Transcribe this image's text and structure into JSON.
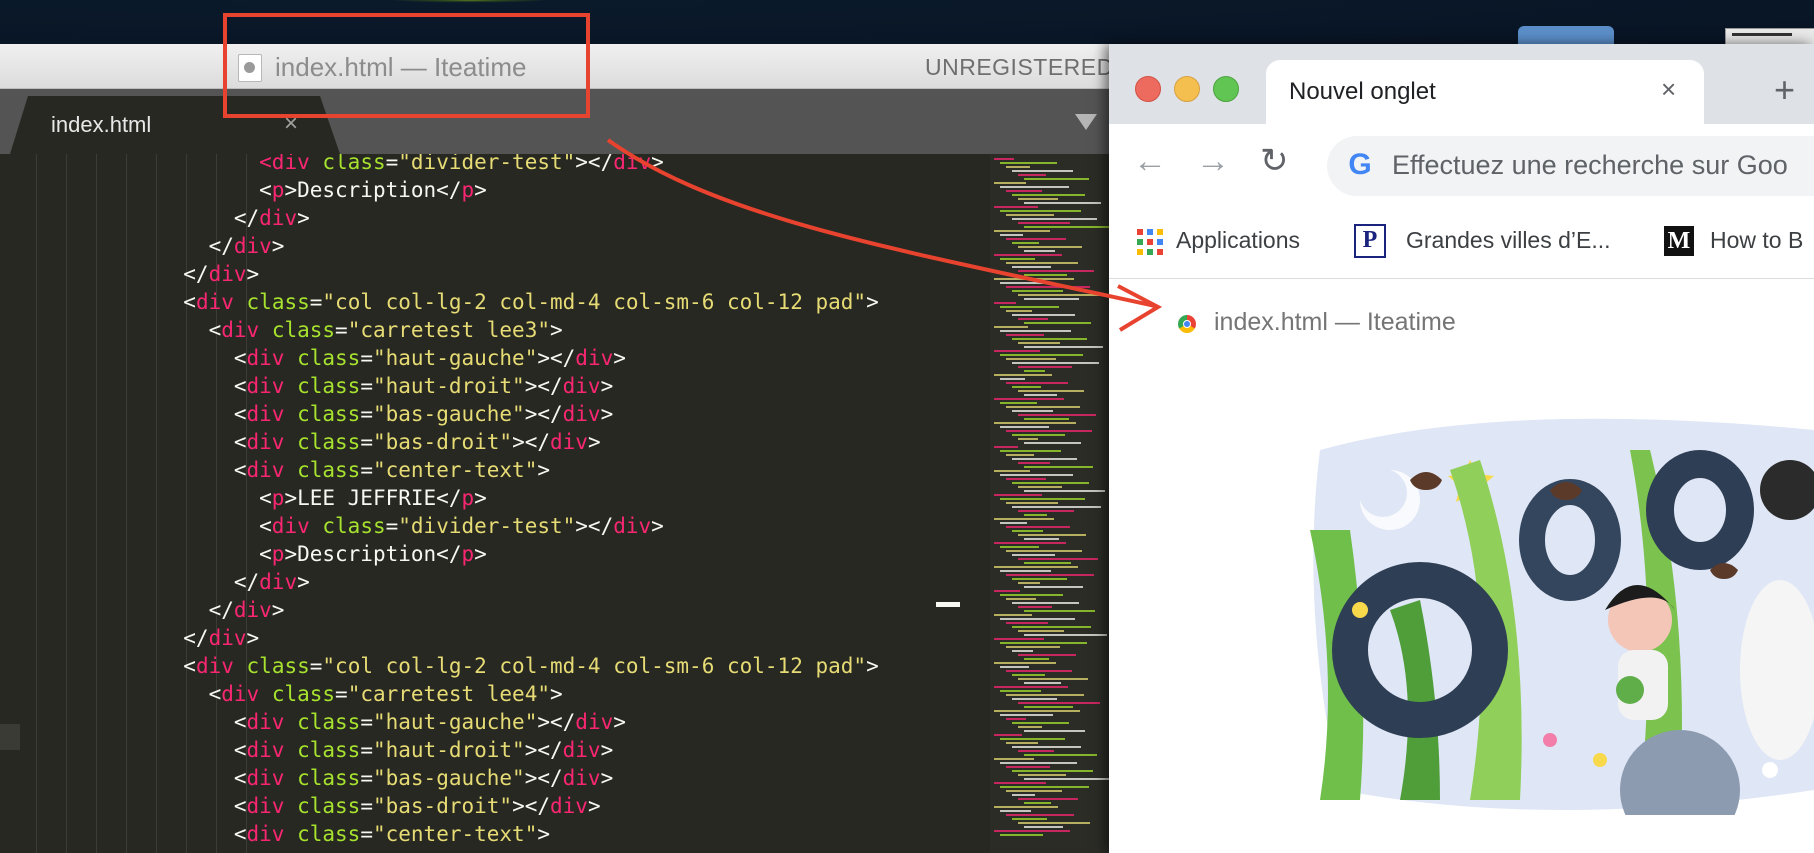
{
  "sublime": {
    "title": "index.html — Iteatime",
    "unregistered": "UNREGISTERED",
    "tab_label": "index.html",
    "tab_close": "×"
  },
  "code_lines": [
    [
      {
        "t": "        "
      },
      {
        "c": "tg",
        "t": "<div"
      },
      {
        "t": " "
      },
      {
        "c": "at",
        "t": "class"
      },
      {
        "t": "="
      },
      {
        "c": "st",
        "t": "\"divider-test\""
      },
      {
        "t": "></"
      },
      {
        "c": "tg",
        "t": "div"
      },
      {
        "t": ">"
      }
    ],
    [
      {
        "t": "        <"
      },
      {
        "c": "tg",
        "t": "p"
      },
      {
        "t": ">Description</"
      },
      {
        "c": "tg",
        "t": "p"
      },
      {
        "t": ">"
      }
    ],
    [
      {
        "t": "      </"
      },
      {
        "c": "tg",
        "t": "div"
      },
      {
        "t": ">"
      }
    ],
    [
      {
        "t": "    </"
      },
      {
        "c": "tg",
        "t": "div"
      },
      {
        "t": ">"
      }
    ],
    [
      {
        "t": "  </"
      },
      {
        "c": "tg",
        "t": "div"
      },
      {
        "t": ">"
      }
    ],
    [
      {
        "t": "  <"
      },
      {
        "c": "tg",
        "t": "div"
      },
      {
        "t": " "
      },
      {
        "c": "at",
        "t": "class"
      },
      {
        "t": "="
      },
      {
        "c": "st",
        "t": "\"col col-lg-2 col-md-4 col-sm-6 col-12 pad\""
      },
      {
        "t": ">"
      }
    ],
    [
      {
        "t": "    <"
      },
      {
        "c": "tg",
        "t": "div"
      },
      {
        "t": " "
      },
      {
        "c": "at",
        "t": "class"
      },
      {
        "t": "="
      },
      {
        "c": "st",
        "t": "\"carretest lee3\""
      },
      {
        "t": ">"
      }
    ],
    [
      {
        "t": "      <"
      },
      {
        "c": "tg",
        "t": "div"
      },
      {
        "t": " "
      },
      {
        "c": "at",
        "t": "class"
      },
      {
        "t": "="
      },
      {
        "c": "st",
        "t": "\"haut-gauche\""
      },
      {
        "t": "></"
      },
      {
        "c": "tg",
        "t": "div"
      },
      {
        "t": ">"
      }
    ],
    [
      {
        "t": "      <"
      },
      {
        "c": "tg",
        "t": "div"
      },
      {
        "t": " "
      },
      {
        "c": "at",
        "t": "class"
      },
      {
        "t": "="
      },
      {
        "c": "st",
        "t": "\"haut-droit\""
      },
      {
        "t": "></"
      },
      {
        "c": "tg",
        "t": "div"
      },
      {
        "t": ">"
      }
    ],
    [
      {
        "t": "      <"
      },
      {
        "c": "tg",
        "t": "div"
      },
      {
        "t": " "
      },
      {
        "c": "at",
        "t": "class"
      },
      {
        "t": "="
      },
      {
        "c": "st",
        "t": "\"bas-gauche\""
      },
      {
        "t": "></"
      },
      {
        "c": "tg",
        "t": "div"
      },
      {
        "t": ">"
      }
    ],
    [
      {
        "t": "      <"
      },
      {
        "c": "tg",
        "t": "div"
      },
      {
        "t": " "
      },
      {
        "c": "at",
        "t": "class"
      },
      {
        "t": "="
      },
      {
        "c": "st",
        "t": "\"bas-droit\""
      },
      {
        "t": "></"
      },
      {
        "c": "tg",
        "t": "div"
      },
      {
        "t": ">"
      }
    ],
    [
      {
        "t": "      <"
      },
      {
        "c": "tg",
        "t": "div"
      },
      {
        "t": " "
      },
      {
        "c": "at",
        "t": "class"
      },
      {
        "t": "="
      },
      {
        "c": "st",
        "t": "\"center-text\""
      },
      {
        "t": ">"
      }
    ],
    [
      {
        "t": "        <"
      },
      {
        "c": "tg",
        "t": "p"
      },
      {
        "t": ">LEE JEFFRIE</"
      },
      {
        "c": "tg",
        "t": "p"
      },
      {
        "t": ">"
      }
    ],
    [
      {
        "t": "        <"
      },
      {
        "c": "tg",
        "t": "div"
      },
      {
        "t": " "
      },
      {
        "c": "at",
        "t": "class"
      },
      {
        "t": "="
      },
      {
        "c": "st",
        "t": "\"divider-test\""
      },
      {
        "t": "></"
      },
      {
        "c": "tg",
        "t": "div"
      },
      {
        "t": ">"
      }
    ],
    [
      {
        "t": "        <"
      },
      {
        "c": "tg",
        "t": "p"
      },
      {
        "t": ">Description</"
      },
      {
        "c": "tg",
        "t": "p"
      },
      {
        "t": ">"
      }
    ],
    [
      {
        "t": "      </"
      },
      {
        "c": "tg",
        "t": "div"
      },
      {
        "t": ">"
      }
    ],
    [
      {
        "t": "    </"
      },
      {
        "c": "tg",
        "t": "div"
      },
      {
        "t": ">"
      }
    ],
    [
      {
        "t": "  </"
      },
      {
        "c": "tg",
        "t": "div"
      },
      {
        "t": ">"
      }
    ],
    [
      {
        "t": "  <"
      },
      {
        "c": "tg",
        "t": "div"
      },
      {
        "t": " "
      },
      {
        "c": "at",
        "t": "class"
      },
      {
        "t": "="
      },
      {
        "c": "st",
        "t": "\"col col-lg-2 col-md-4 col-sm-6 col-12 pad\""
      },
      {
        "t": ">"
      }
    ],
    [
      {
        "t": "    <"
      },
      {
        "c": "tg",
        "t": "div"
      },
      {
        "t": " "
      },
      {
        "c": "at",
        "t": "class"
      },
      {
        "t": "="
      },
      {
        "c": "st",
        "t": "\"carretest lee4\""
      },
      {
        "t": ">"
      }
    ],
    [
      {
        "t": "      <"
      },
      {
        "c": "tg",
        "t": "div"
      },
      {
        "t": " "
      },
      {
        "c": "at",
        "t": "class"
      },
      {
        "t": "="
      },
      {
        "c": "st",
        "t": "\"haut-gauche\""
      },
      {
        "t": "></"
      },
      {
        "c": "tg",
        "t": "div"
      },
      {
        "t": ">"
      }
    ],
    [
      {
        "t": "      <"
      },
      {
        "c": "tg",
        "t": "div"
      },
      {
        "t": " "
      },
      {
        "c": "at",
        "t": "class"
      },
      {
        "t": "="
      },
      {
        "c": "st",
        "t": "\"haut-droit\""
      },
      {
        "t": "></"
      },
      {
        "c": "tg",
        "t": "div"
      },
      {
        "t": ">"
      }
    ],
    [
      {
        "t": "      <"
      },
      {
        "c": "tg",
        "t": "div"
      },
      {
        "t": " "
      },
      {
        "c": "at",
        "t": "class"
      },
      {
        "t": "="
      },
      {
        "c": "st",
        "t": "\"bas-gauche\""
      },
      {
        "t": "></"
      },
      {
        "c": "tg",
        "t": "div"
      },
      {
        "t": ">"
      }
    ],
    [
      {
        "t": "      <"
      },
      {
        "c": "tg",
        "t": "div"
      },
      {
        "t": " "
      },
      {
        "c": "at",
        "t": "class"
      },
      {
        "t": "="
      },
      {
        "c": "st",
        "t": "\"bas-droit\""
      },
      {
        "t": "></"
      },
      {
        "c": "tg",
        "t": "div"
      },
      {
        "t": ">"
      }
    ],
    [
      {
        "t": "      <"
      },
      {
        "c": "tg",
        "t": "div"
      },
      {
        "t": " "
      },
      {
        "c": "at",
        "t": "class"
      },
      {
        "t": "="
      },
      {
        "c": "st",
        "t": "\"center-text\""
      },
      {
        "t": ">"
      }
    ]
  ],
  "chrome": {
    "tab_title": "Nouvel onglet",
    "tab_close": "×",
    "new_tab": "+",
    "back": "←",
    "forward": "→",
    "reload": "↻",
    "google_g": "G",
    "omnibox_placeholder": "Effectuez une recherche sur Goo",
    "bookmarks": [
      {
        "label": "Applications",
        "icon": "apps-grid-icon"
      },
      {
        "label": "Grandes villes d’E...",
        "icon": "P"
      },
      {
        "label": "How to B",
        "icon": "M"
      }
    ],
    "drag_ghost_label": "index.html — Iteatime"
  },
  "colors": {
    "sublime_bg": "#272822",
    "tag": "#f92672",
    "attr": "#a6e22e",
    "string": "#e6db74",
    "annotation": "#e8432f"
  }
}
